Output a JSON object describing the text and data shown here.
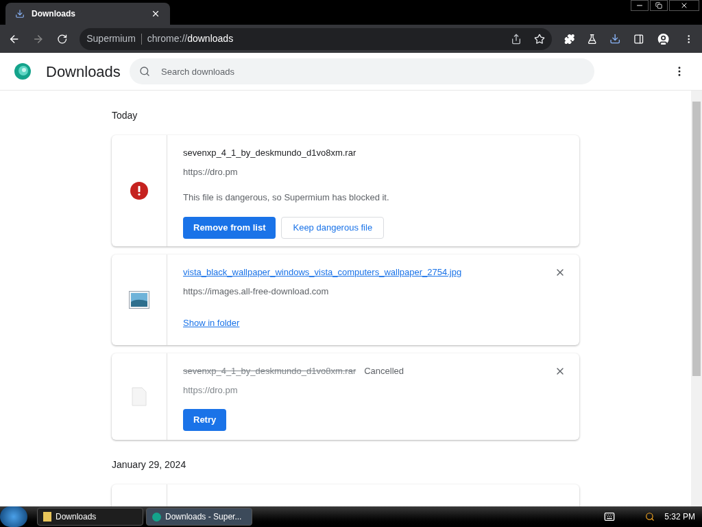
{
  "tab": {
    "title": "Downloads"
  },
  "address_bar": {
    "site": "Supermium",
    "url_prefix": "chrome://",
    "url_path": "downloads"
  },
  "page": {
    "title": "Downloads",
    "search": {
      "placeholder": "Search downloads"
    }
  },
  "groups": [
    {
      "date": "Today",
      "items": [
        {
          "kind": "dangerous",
          "filename": "sevenxp_4_1_by_deskmundo_d1vo8xm.rar",
          "source": "https://dro.pm",
          "message": "This file is dangerous, so Supermium has blocked it.",
          "buttons": [
            "Remove from list",
            "Keep dangerous file"
          ]
        },
        {
          "kind": "complete",
          "filename": "vista_black_wallpaper_windows_vista_computers_wallpaper_2754.jpg",
          "source": "https://images.all-free-download.com",
          "link": "Show in folder"
        },
        {
          "kind": "cancelled",
          "filename": "sevenxp_4_1_by_deskmundo_d1vo8xm.rar",
          "status": "Cancelled",
          "source": "https://dro.pm",
          "buttons": [
            "Retry"
          ]
        }
      ]
    },
    {
      "date": "January 29, 2024",
      "items": [
        {
          "kind": "hidden"
        }
      ]
    }
  ],
  "taskbar": {
    "items": [
      {
        "label": "Downloads",
        "selected": false
      },
      {
        "label": "Downloads - Super...",
        "selected": true
      }
    ],
    "time": "5:32 PM"
  }
}
